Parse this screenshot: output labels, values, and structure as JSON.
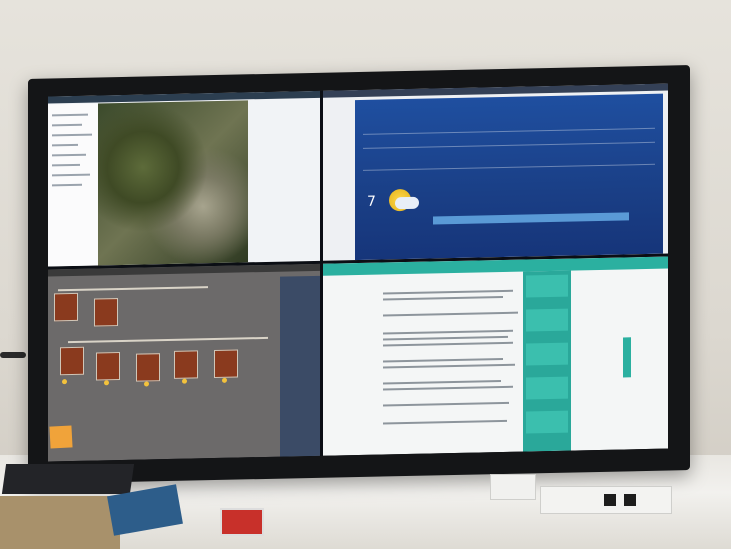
{
  "scene": {
    "description_type": "photo-of-wall-display",
    "colors": {
      "wall": "#dcd8d0",
      "bezel": "#141517",
      "weather_panel": "#1a3f86",
      "scada_panel": "#6c6a6a",
      "doc_accent": "#2aa89a",
      "sticky_note": "#f0a33a"
    }
  },
  "screen": {
    "quadrants": [
      {
        "name": "map-viewer",
        "theme": "light"
      },
      {
        "name": "weather-dashboard",
        "theme": "blue"
      },
      {
        "name": "scada-process",
        "theme": "gray"
      },
      {
        "name": "document-page",
        "theme": "teal"
      }
    ]
  },
  "weather": {
    "icon": "sun-cloud-icon",
    "temp": "7"
  }
}
